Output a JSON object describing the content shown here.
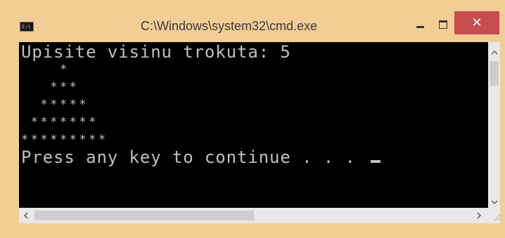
{
  "window": {
    "title": "C:\\Windows\\system32\\cmd.exe",
    "app_icon_text": "C:\\",
    "controls": {
      "minimize": "–",
      "maximize": "□",
      "close": "✕"
    }
  },
  "console": {
    "prompt_line": "Upisite visinu trokuta: 5",
    "triangle_rows": [
      "    *",
      "   ***",
      "  *****",
      " *******",
      "*********"
    ],
    "press_line": "Press any key to continue . . . "
  },
  "icons": {
    "scroll_up": "up-arrow-icon",
    "scroll_down": "down-arrow-icon",
    "scroll_left": "left-arrow-icon",
    "scroll_right": "right-arrow-icon"
  },
  "colors": {
    "frame": "#f3cd96",
    "console_bg": "#000000",
    "console_fg": "#c0c0c0",
    "close_button": "#c54d4d"
  }
}
